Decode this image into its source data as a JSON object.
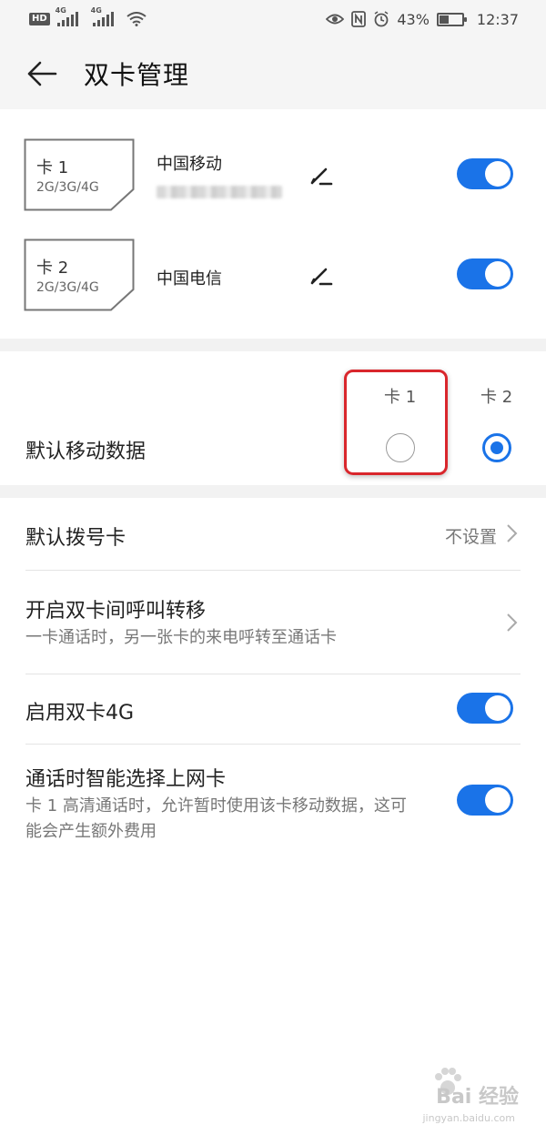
{
  "status_bar": {
    "hd": "HD",
    "net1": "4G",
    "net2": "4G",
    "battery_percent": "43%",
    "time": "12:37",
    "icons": [
      "eye-icon",
      "nfc-icon",
      "alarm-icon",
      "battery-icon",
      "wifi-icon"
    ]
  },
  "header": {
    "title": "双卡管理"
  },
  "sim_cards": [
    {
      "name": "卡 1",
      "network": "2G/3G/4G",
      "carrier": "中国移动",
      "enabled": true
    },
    {
      "name": "卡 2",
      "network": "2G/3G/4G",
      "carrier": "中国电信",
      "enabled": true
    }
  ],
  "default_data": {
    "label": "默认移动数据",
    "col1": "卡 1",
    "col2": "卡 2",
    "selected": "卡 2"
  },
  "settings": {
    "default_dial": {
      "title": "默认拨号卡",
      "value": "不设置"
    },
    "call_forward": {
      "title": "开启双卡间呼叫转移",
      "subtitle": "一卡通话时，另一张卡的来电呼转至通话卡"
    },
    "dual_4g": {
      "title": "启用双卡4G",
      "enabled": true
    },
    "smart_data": {
      "title": "通话时智能选择上网卡",
      "subtitle": "卡 1 高清通话时，允许暂时使用该卡移动数据，这可能会产生额外费用",
      "enabled": true
    }
  },
  "watermark": {
    "text": "Bai 经验",
    "url": "jingyan.baidu.com"
  },
  "colors": {
    "accent": "#1a73e8",
    "highlight": "#d9262c",
    "header_bg": "#f5f5f5"
  }
}
